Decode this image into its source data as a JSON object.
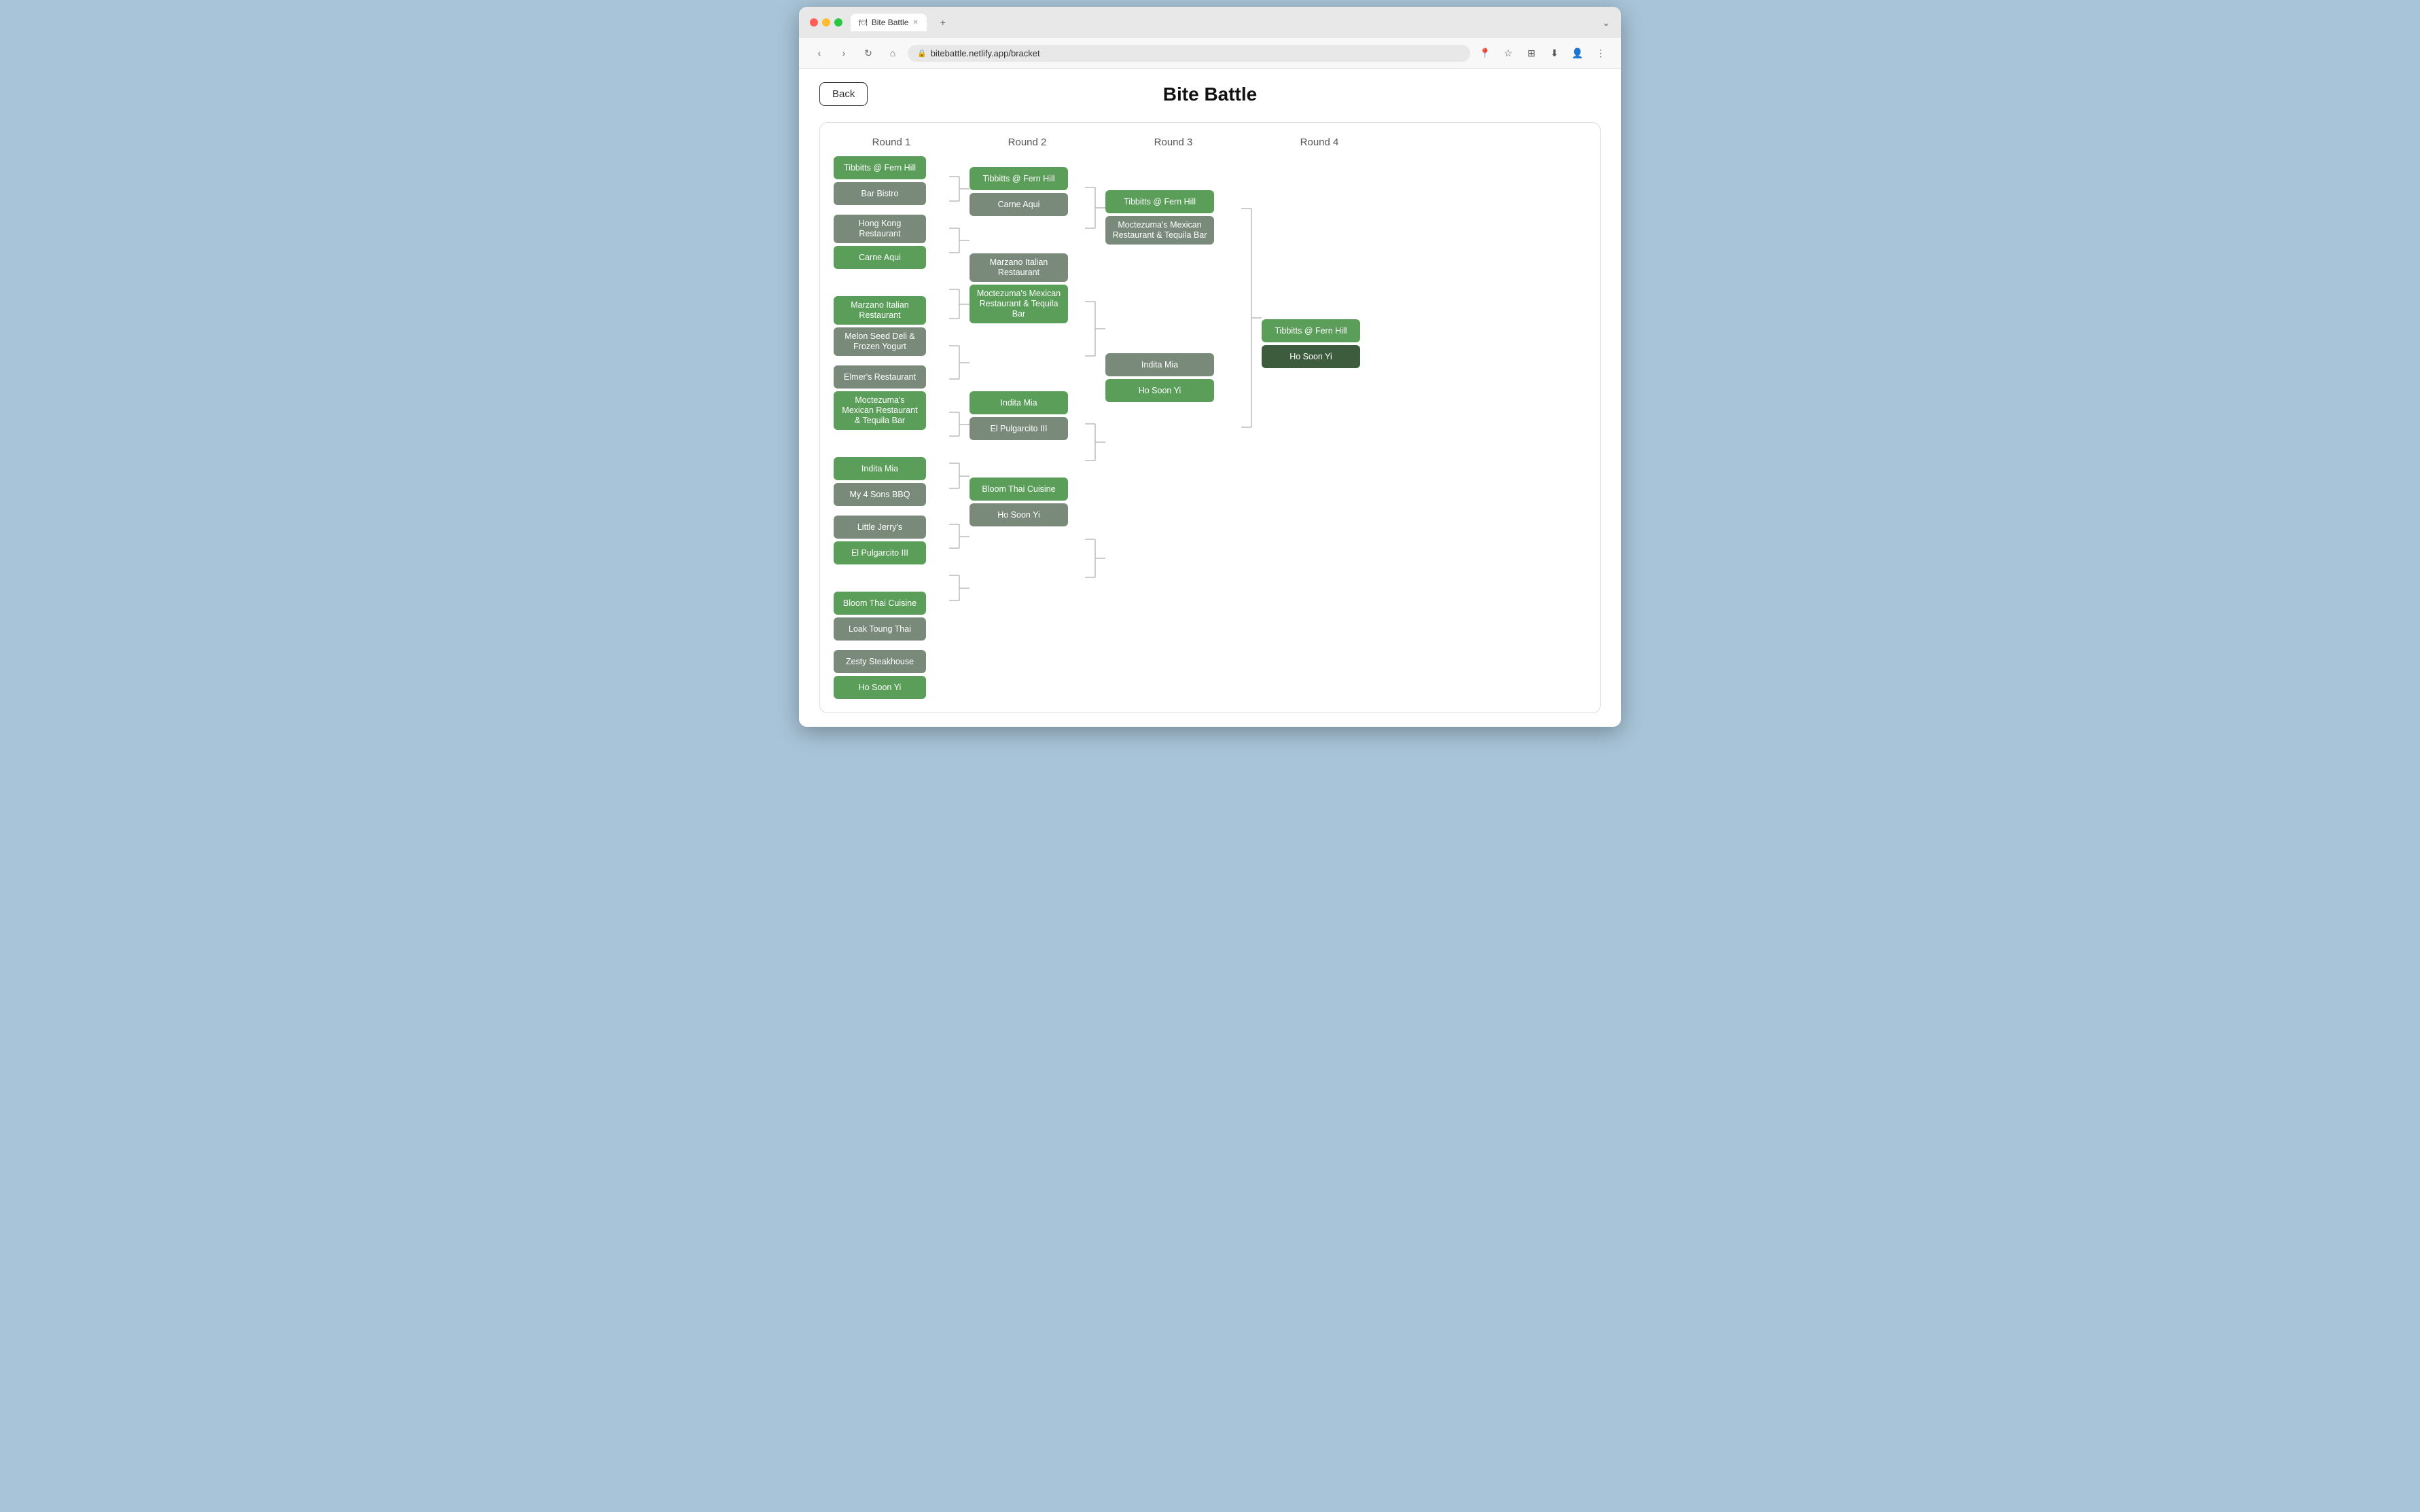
{
  "browser": {
    "tab_title": "Bite Battle",
    "url": "bitebattle.netlify.app/bracket",
    "favicon": "🍽"
  },
  "app": {
    "title": "Bite Battle",
    "back_label": "Back"
  },
  "rounds": [
    {
      "label": "Round 1",
      "matches": [
        [
          {
            "name": "Tibbitts @ Fern Hill",
            "style": "green"
          },
          {
            "name": "Bar Bistro",
            "style": "gray"
          }
        ],
        [
          {
            "name": "Hong Kong Restaurant",
            "style": "gray"
          },
          {
            "name": "Carne Aqui",
            "style": "green"
          }
        ],
        [
          {
            "name": "Marzano Italian Restaurant",
            "style": "green"
          },
          {
            "name": "Melon Seed Deli & Frozen Yogurt",
            "style": "gray"
          }
        ],
        [
          {
            "name": "Elmer's Restaurant",
            "style": "gray"
          },
          {
            "name": "Moctezuma's Mexican Restaurant & Tequila Bar",
            "style": "green"
          }
        ],
        [
          {
            "name": "Indita Mia",
            "style": "green"
          },
          {
            "name": "My 4 Sons BBQ",
            "style": "gray"
          }
        ],
        [
          {
            "name": "Little Jerry's",
            "style": "gray"
          },
          {
            "name": "El Pulgarcito III",
            "style": "green"
          }
        ],
        [
          {
            "name": "Bloom Thai Cuisine",
            "style": "green"
          },
          {
            "name": "Loak Toung Thai",
            "style": "gray"
          }
        ],
        [
          {
            "name": "Zesty Steakhouse",
            "style": "gray"
          },
          {
            "name": "Ho Soon Yi",
            "style": "green"
          }
        ]
      ]
    },
    {
      "label": "Round 2",
      "matches": [
        [
          {
            "name": "Tibbitts @ Fern Hill",
            "style": "green"
          },
          {
            "name": "Carne Aqui",
            "style": "gray"
          }
        ],
        [
          {
            "name": "Marzano Italian Restaurant",
            "style": "gray"
          },
          {
            "name": "Moctezuma's Mexican Restaurant & Tequila Bar",
            "style": "green"
          }
        ],
        [
          {
            "name": "Indita Mia",
            "style": "green"
          },
          {
            "name": "El Pulgarcito III",
            "style": "gray"
          }
        ],
        [
          {
            "name": "Bloom Thai Cuisine",
            "style": "green"
          },
          {
            "name": "Ho Soon Yi",
            "style": "gray"
          }
        ]
      ]
    },
    {
      "label": "Round 3",
      "matches": [
        [
          {
            "name": "Tibbitts @ Fern Hill",
            "style": "green"
          },
          {
            "name": "Moctezuma's Mexican Restaurant & Tequila Bar",
            "style": "gray"
          }
        ],
        [
          {
            "name": "Indita Mia",
            "style": "gray"
          },
          {
            "name": "Ho Soon Yi",
            "style": "green"
          }
        ]
      ]
    },
    {
      "label": "Round 4",
      "matches": [
        [
          {
            "name": "Tibbitts @ Fern Hill",
            "style": "green"
          },
          {
            "name": "Ho Soon Yi",
            "style": "dark"
          }
        ]
      ]
    }
  ]
}
